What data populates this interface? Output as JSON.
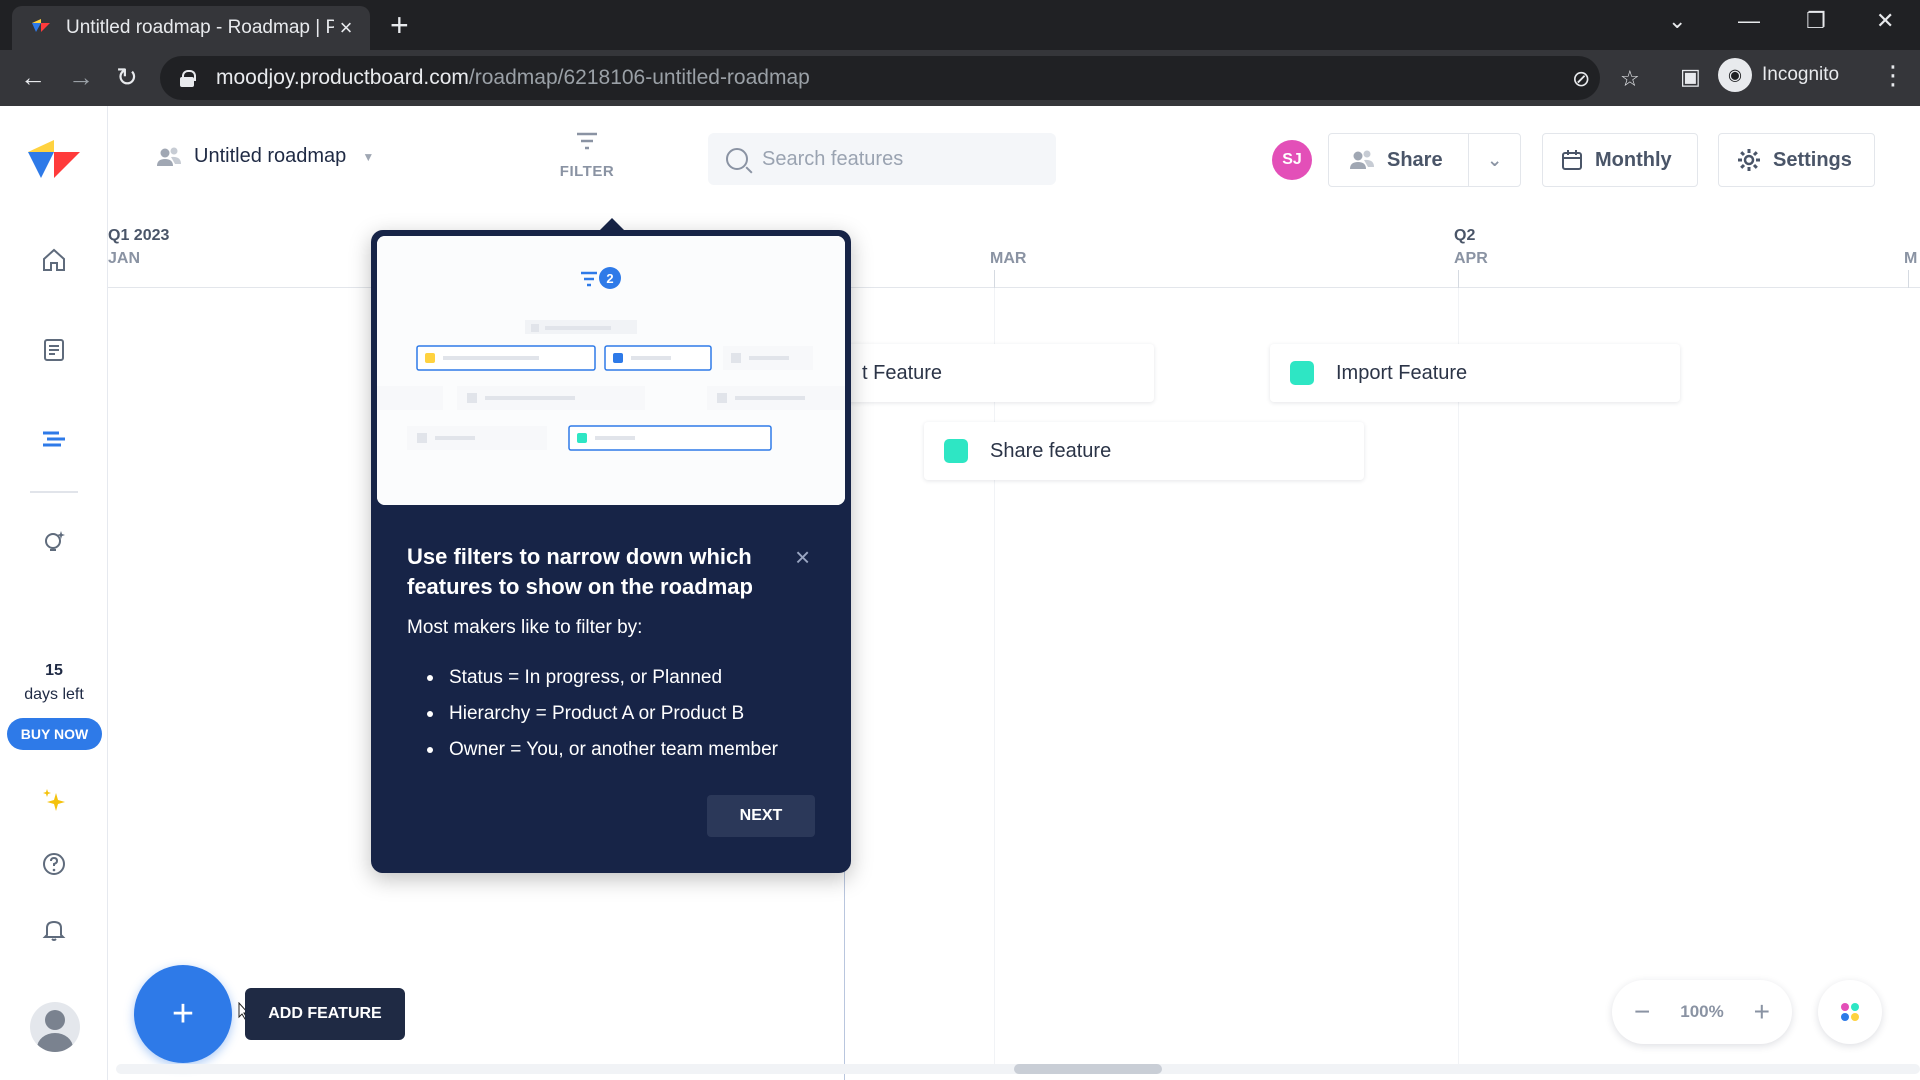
{
  "browser": {
    "tab_title": "Untitled roadmap - Roadmap | Pr",
    "url_host": "moodjoy.productboard.com",
    "url_path": "/roadmap/6218106-untitled-roadmap",
    "incognito_label": "Incognito"
  },
  "sidebar": {
    "trial_days": "15",
    "trial_label": "days left",
    "buy_now": "BUY NOW"
  },
  "header": {
    "roadmap_title": "Untitled roadmap",
    "filter_label": "FILTER",
    "search_placeholder": "Search features",
    "avatar_initials": "SJ",
    "share_label": "Share",
    "monthly_label": "Monthly",
    "settings_label": "Settings"
  },
  "timeline": {
    "quarters": [
      "Q1 2023",
      "Q2"
    ],
    "months": [
      "JAN",
      "MAR",
      "APR",
      "M"
    ]
  },
  "features": [
    {
      "name": "t Feature",
      "color": "#2ee6c4"
    },
    {
      "name": "Import Feature",
      "color": "#2ee6c4"
    },
    {
      "name": "Share feature",
      "color": "#2ee6c4"
    }
  ],
  "popover": {
    "badge_count": "2",
    "title": "Use filters to narrow down which features to show on the roadmap",
    "subtitle": "Most makers like to filter by:",
    "items": [
      "Status = In progress, or Planned",
      "Hierarchy = Product A or Product B",
      "Owner = You, or another team member"
    ],
    "next_label": "NEXT"
  },
  "bottom": {
    "add_feature_tooltip": "ADD FEATURE",
    "zoom_value": "100%"
  },
  "colors": {
    "accent": "#2e7ae8",
    "popover_bg": "#172447",
    "feature_swatch": "#2ee6c4",
    "avatar": "#e34fb8"
  }
}
